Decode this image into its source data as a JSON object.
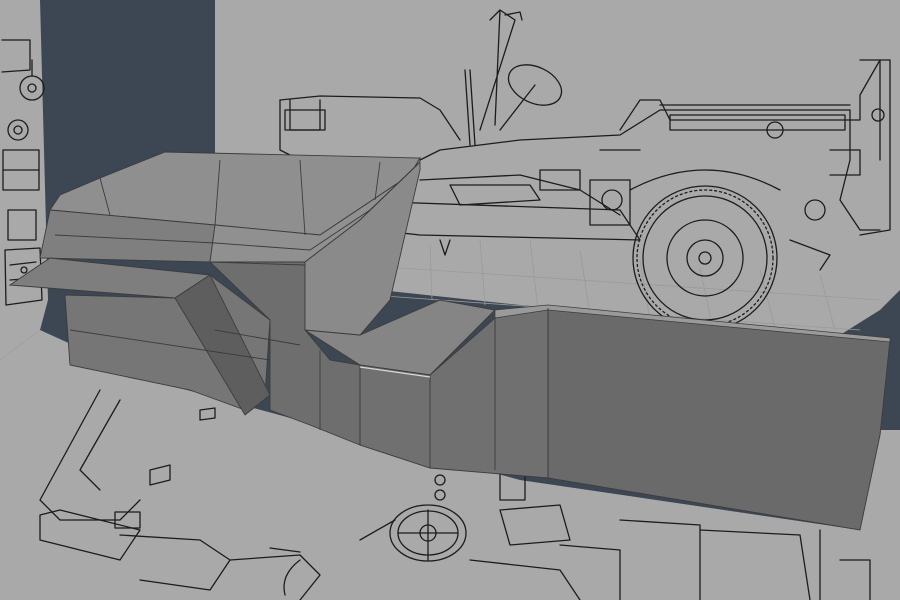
{
  "viewport": {
    "background": "#3d4754",
    "plane_color": "#a9a9a9",
    "blueprint_line_color": "#1c1c1c",
    "mesh_colors": {
      "top": "#8f8f8f",
      "front": "#767676",
      "side": "#858585",
      "dark": "#5e5e5e",
      "edge": "#3c3c3c"
    }
  },
  "scene": {
    "reference_planes": [
      "side-view-blueprint",
      "top-view-blueprint",
      "front-view-blueprint"
    ],
    "model": "jeep-body-mesh-in-progress"
  }
}
